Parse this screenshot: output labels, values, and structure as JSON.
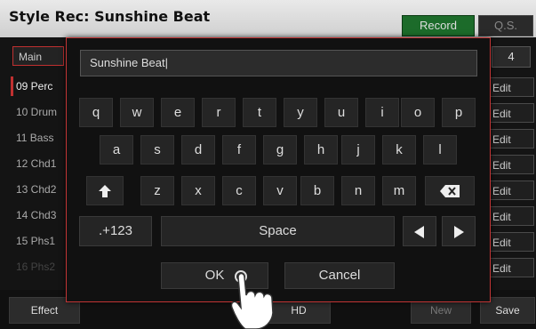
{
  "titlebar": {
    "title": "Style Rec: Sunshine Beat",
    "tab_record": "Record",
    "tab_qs": "Q.S."
  },
  "controls": {
    "mode_button": "Main",
    "number_value": "4"
  },
  "tracks": [
    {
      "label": "09 Perc"
    },
    {
      "label": "10 Drum"
    },
    {
      "label": "11 Bass"
    },
    {
      "label": "12 Chd1"
    },
    {
      "label": "13 Chd2"
    },
    {
      "label": "14 Chd3"
    },
    {
      "label": "15 Phs1"
    },
    {
      "label": "16 Phs2"
    }
  ],
  "edit_label": "Edit",
  "bottom": {
    "effect": "Effect",
    "hd": "HD",
    "new": "New",
    "save": "Save"
  },
  "dialog": {
    "text_value": "Sunshine Beat|",
    "row1": [
      "q",
      "w",
      "e",
      "r",
      "t",
      "y",
      "u",
      "i",
      "o",
      "p"
    ],
    "row2": [
      "a",
      "s",
      "d",
      "f",
      "g",
      "h",
      "j",
      "k",
      "l"
    ],
    "row3": [
      "z",
      "x",
      "c",
      "v",
      "b",
      "n",
      "m"
    ],
    "numbers_key": ".+123",
    "space_key": "Space",
    "ok": "OK",
    "cancel": "Cancel"
  },
  "colors": {
    "accent": "#c23535",
    "record_tab": "#1c6b2a",
    "background": "#141414"
  }
}
